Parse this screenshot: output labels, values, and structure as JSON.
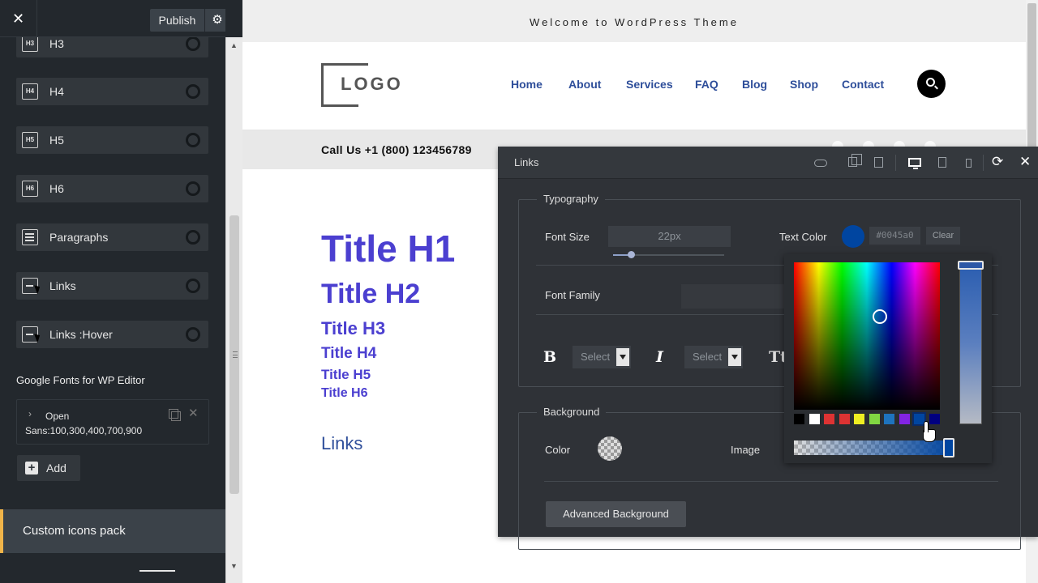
{
  "sidebar": {
    "close_icon": "close-icon",
    "publish_label": "Publish",
    "settings_icon": "gear-icon",
    "items": [
      {
        "label": "H3",
        "icon": "H3"
      },
      {
        "label": "H4",
        "icon": "H4"
      },
      {
        "label": "H5",
        "icon": "H5"
      },
      {
        "label": "H6",
        "icon": "H6"
      },
      {
        "label": "Paragraphs",
        "icon": "paragraph-icon"
      },
      {
        "label": "Links",
        "icon": "minus-icon"
      },
      {
        "label": "Links :Hover",
        "icon": "minus-icon"
      }
    ],
    "google_fonts_label": "Google Fonts for WP Editor",
    "google_font_entry": "Open Sans:100,300,400,700,900",
    "add_label": "Add",
    "custom_icons_label": "Custom icons pack"
  },
  "preview": {
    "welcome": "Welcome to WordPress Theme",
    "logo_text": "LOGO",
    "nav": [
      "Home",
      "About",
      "Services",
      "FAQ",
      "Blog",
      "Shop",
      "Contact"
    ],
    "call_us": "Call Us +1 (800) 123456789",
    "titles": {
      "h1": "Title H1",
      "h2": "Title H2",
      "h3": "Title H3",
      "h4": "Title H4",
      "h5": "Title H5",
      "h6": "Title H6"
    },
    "links_text": "Links",
    "title_color": "#4b3fd0",
    "link_color": "#2e4e9a"
  },
  "panel": {
    "title": "Links",
    "typography": {
      "legend": "Typography",
      "font_size_label": "Font Size",
      "font_size_value": "22px",
      "font_size_slider_fraction": 0.16,
      "text_color_label": "Text Color",
      "text_color_value": "#0045a0",
      "clear_label": "Clear",
      "font_family_label": "Font Family",
      "bold_glyph": "B",
      "italic_glyph": "I",
      "transform_glyph": "Tt",
      "select_1": "Select",
      "select_2": "Select"
    },
    "background": {
      "legend": "Background",
      "color_label": "Color",
      "image_label": "Image",
      "advanced_label": "Advanced Background"
    }
  },
  "color_picker": {
    "selected_color": "#0045a0",
    "palette": [
      "#000000",
      "#ffffff",
      "#dd3333",
      "#dd3333",
      "#eeee22",
      "#81d742",
      "#1e73be",
      "#8224e3",
      "#0045a0",
      "#000080"
    ]
  }
}
